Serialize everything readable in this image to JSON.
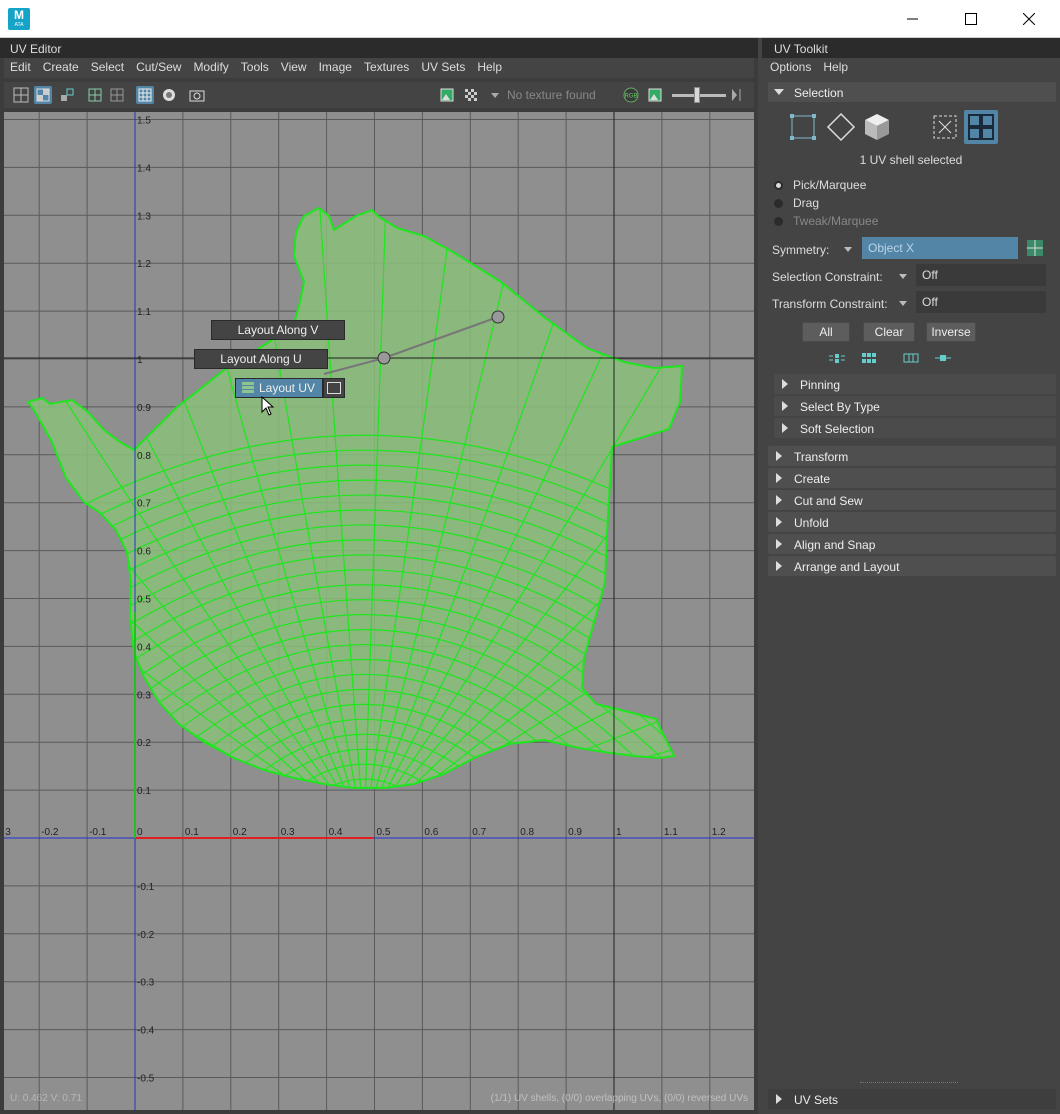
{
  "app": {
    "icon_letter": "M",
    "icon_sub": "ATA"
  },
  "window_controls": {
    "minimize_icon": "minimize-icon",
    "maximize_icon": "maximize-icon",
    "close_icon": "close-icon"
  },
  "uv_editor": {
    "tab_label": "UV Editor",
    "menu": [
      "Edit",
      "Create",
      "Select",
      "Cut/Sew",
      "Modify",
      "Tools",
      "View",
      "Image",
      "Textures",
      "UV Sets",
      "Help"
    ],
    "toolbar": {
      "texture_status": "No texture found",
      "rgb_label": "RGB"
    },
    "axis_u_labels": [
      "3",
      "-0.2",
      "-0.1",
      "0",
      "0.1",
      "0.2",
      "0.3",
      "0.4",
      "0.5",
      "0.6",
      "0.7",
      "0.8",
      "0.9",
      "1",
      "1.1",
      "1.2"
    ],
    "axis_v_labels": [
      "1.5",
      "1.4",
      "1.3",
      "1.2",
      "1.1",
      "1",
      "0.9",
      "0.8",
      "0.7",
      "0.6",
      "0.5",
      "0.4",
      "0.3",
      "0.2",
      "0.1",
      "-0.1",
      "-0.2",
      "-0.3",
      "-0.4",
      "-0.5"
    ],
    "marking_menu": {
      "layout_along_v": "Layout Along V",
      "layout_along_u": "Layout Along U",
      "layout_uv": "Layout UV"
    },
    "status_left": "U:  0.462 V:  0.71",
    "status_right": "(1/1) UV shells, (0/0) overlapping UVs, (0/0) reversed UVs"
  },
  "uv_toolkit": {
    "tab_label": "UV Toolkit",
    "menu": [
      "Options",
      "Help"
    ],
    "selection": {
      "title": "Selection",
      "status": "1 UV shell selected",
      "modes": [
        "Pick/Marquee",
        "Drag",
        "Tweak/Marquee"
      ],
      "symmetry_label": "Symmetry:",
      "symmetry_value": "Object X",
      "selection_constraint_label": "Selection Constraint:",
      "selection_constraint_value": "Off",
      "transform_constraint_label": "Transform Constraint:",
      "transform_constraint_value": "Off",
      "buttons": [
        "All",
        "Clear",
        "Inverse"
      ],
      "subsections": [
        "Pinning",
        "Select By Type",
        "Soft Selection"
      ]
    },
    "sections": [
      "Transform",
      "Create",
      "Cut and Sew",
      "Unfold",
      "Align and Snap",
      "Arrange and Layout"
    ],
    "bottom_section": "UV Sets"
  },
  "colors": {
    "mesh": "#1ee61e",
    "mesh_fill": "#8bbf7a",
    "viewport_bg": "#8f8f8f",
    "highlight": "#5285a6",
    "u_axis": "#e02020",
    "v_axis": "#2020e0"
  }
}
